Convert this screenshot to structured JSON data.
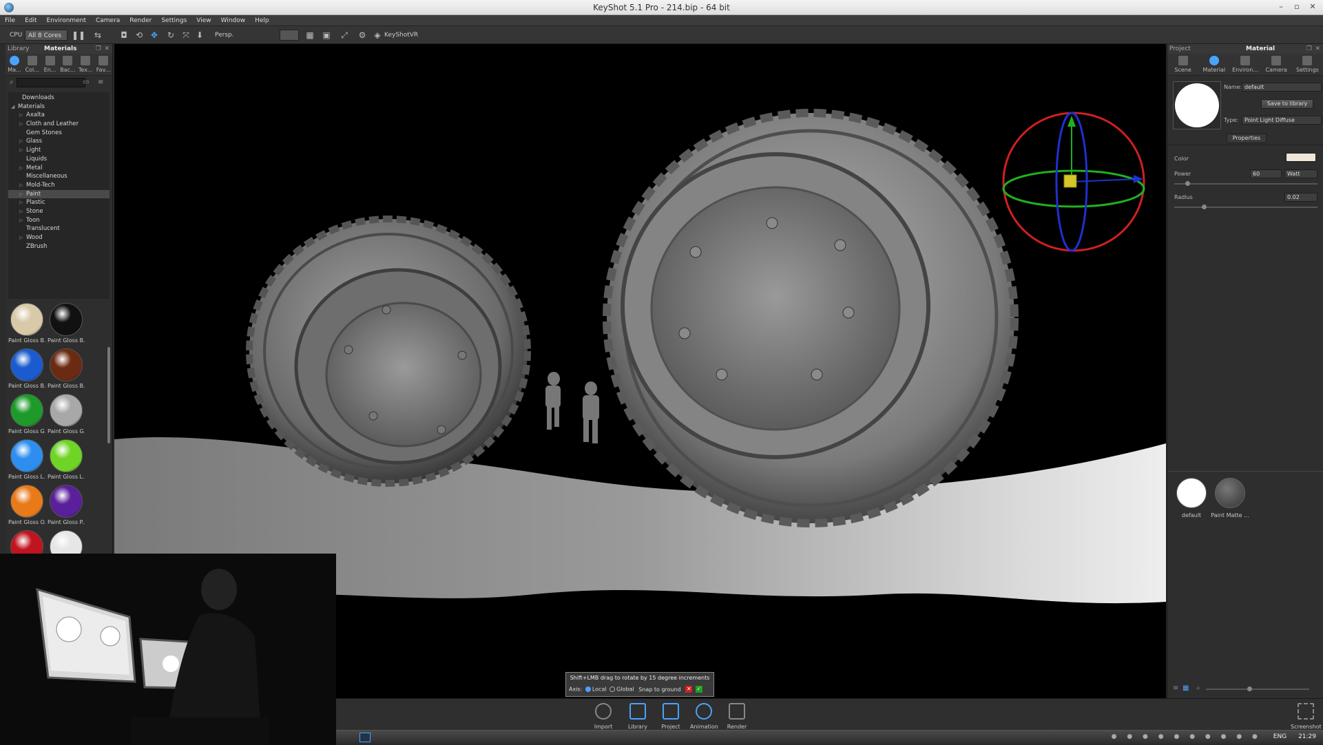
{
  "window": {
    "title": "KeyShot 5.1 Pro  - 214.bip  - 64 bit"
  },
  "menu": [
    "File",
    "Edit",
    "Environment",
    "Camera",
    "Render",
    "Settings",
    "View",
    "Window",
    "Help"
  ],
  "toolbar": {
    "cpu_label": "CPU",
    "cores": "All 8 Cores",
    "projection": "Persp.",
    "vr_label": "KeyShotVR"
  },
  "library": {
    "title": "Library",
    "tab_title": "Materials",
    "tabs": [
      "Ma...",
      "Col...",
      "En...",
      "Bac...",
      "Tex...",
      "Fav..."
    ],
    "tree": [
      {
        "label": "Downloads",
        "indent": 1,
        "arrow": ""
      },
      {
        "label": "Materials",
        "indent": 0,
        "arrow": "◢"
      },
      {
        "label": "Axalta",
        "indent": 2,
        "arrow": "▷"
      },
      {
        "label": "Cloth and Leather",
        "indent": 2,
        "arrow": "▷"
      },
      {
        "label": "Gem Stones",
        "indent": 2,
        "arrow": ""
      },
      {
        "label": "Glass",
        "indent": 2,
        "arrow": "▷"
      },
      {
        "label": "Light",
        "indent": 2,
        "arrow": "▷"
      },
      {
        "label": "Liquids",
        "indent": 2,
        "arrow": ""
      },
      {
        "label": "Metal",
        "indent": 2,
        "arrow": "▷"
      },
      {
        "label": "Miscellaneous",
        "indent": 2,
        "arrow": ""
      },
      {
        "label": "Mold-Tech",
        "indent": 2,
        "arrow": "▷"
      },
      {
        "label": "Paint",
        "indent": 2,
        "arrow": "▷",
        "selected": true
      },
      {
        "label": "Plastic",
        "indent": 2,
        "arrow": "▷"
      },
      {
        "label": "Stone",
        "indent": 2,
        "arrow": "▷"
      },
      {
        "label": "Toon",
        "indent": 2,
        "arrow": "▷"
      },
      {
        "label": "Translucent",
        "indent": 2,
        "arrow": ""
      },
      {
        "label": "Wood",
        "indent": 2,
        "arrow": "▷"
      },
      {
        "label": "ZBrush",
        "indent": 2,
        "arrow": ""
      }
    ],
    "thumbs": [
      {
        "label": "Paint Gloss B...",
        "color": "#d8c9a8"
      },
      {
        "label": "Paint Gloss B...",
        "color": "#111111"
      },
      {
        "label": "Paint Gloss B...",
        "color": "#1a5bd0"
      },
      {
        "label": "Paint Gloss B...",
        "color": "#6b2a12"
      },
      {
        "label": "Paint Gloss G...",
        "color": "#1e9a2a"
      },
      {
        "label": "Paint Gloss G...",
        "color": "#a8a8a8"
      },
      {
        "label": "Paint Gloss L...",
        "color": "#2e8ef0"
      },
      {
        "label": "Paint Gloss L...",
        "color": "#6fd425"
      },
      {
        "label": "Paint Gloss O...",
        "color": "#e87a1a"
      },
      {
        "label": "Paint Gloss P...",
        "color": "#5a1f9a"
      },
      {
        "label": "",
        "color": "#c0141e"
      },
      {
        "label": "",
        "color": "#e6e6e6"
      }
    ]
  },
  "project": {
    "title": "Project",
    "tab_title": "Material",
    "tabs": [
      "Scene",
      "Material",
      "Environ...",
      "Camera",
      "Settings"
    ],
    "name_label": "Name:",
    "name_value": "default",
    "save_button": "Save to library",
    "type_label": "Type:",
    "type_value": "Point Light Diffuse",
    "properties_tab": "Properties",
    "color_label": "Color",
    "color_value": "#efe6d8",
    "power_label": "Power",
    "power_value": "60",
    "power_unit": "Watt",
    "radius_label": "Radius",
    "radius_value": "0.02",
    "swatches": [
      {
        "label": "default",
        "color": "#ffffff"
      },
      {
        "label": "Paint Matte ...",
        "color": "#555555"
      }
    ]
  },
  "hint": {
    "text": "Shift+LMB drag to rotate by 15 degree increments",
    "axis_label": "Axis:",
    "local_label": "Local",
    "global_label": "Global",
    "snap_label": "Snap to ground"
  },
  "dock": [
    "Import",
    "Library",
    "Project",
    "Animation",
    "Render"
  ],
  "dock_right": "Screenshot",
  "taskbar": {
    "lang": "ENG",
    "time": "21:29"
  }
}
